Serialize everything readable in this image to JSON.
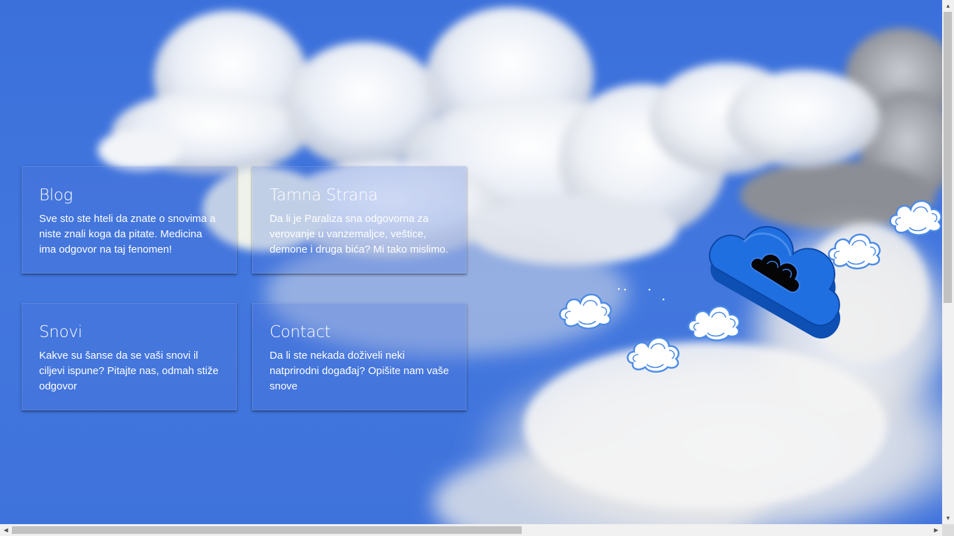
{
  "tiles": [
    {
      "title": "Blog",
      "text": "Sve sto ste hteli da znate o snovima a niste znali koga da pitate. Medicina ima odgovor na taj fenomen!"
    },
    {
      "title": "Tamna Strana",
      "text": "Da li je Paraliza sna odgovorna za verovanje u vanzemaljce, veštice, demone i druga bića? Mi tako mislimo."
    },
    {
      "title": "Snovi",
      "text": "Kakve su šanse da se vaši snovi il ciljevi ispune? Pitajte nas, odmah stiže odgovor"
    },
    {
      "title": "Contact",
      "text": "Da li ste nekada doživeli neki natprirodni događaj? Opišite nam vaše snove"
    }
  ],
  "scrollbars": {
    "up": "▲",
    "down": "▼",
    "left": "◀",
    "right": "▶"
  },
  "colors": {
    "sky": "#3d74dd",
    "tile_text": "#ffffff",
    "logo_cloud": "#1f6fe0"
  },
  "icons": {
    "logo": "blue-3d-cloud-icon",
    "small_clouds": "white-outline-cloud-icon"
  }
}
